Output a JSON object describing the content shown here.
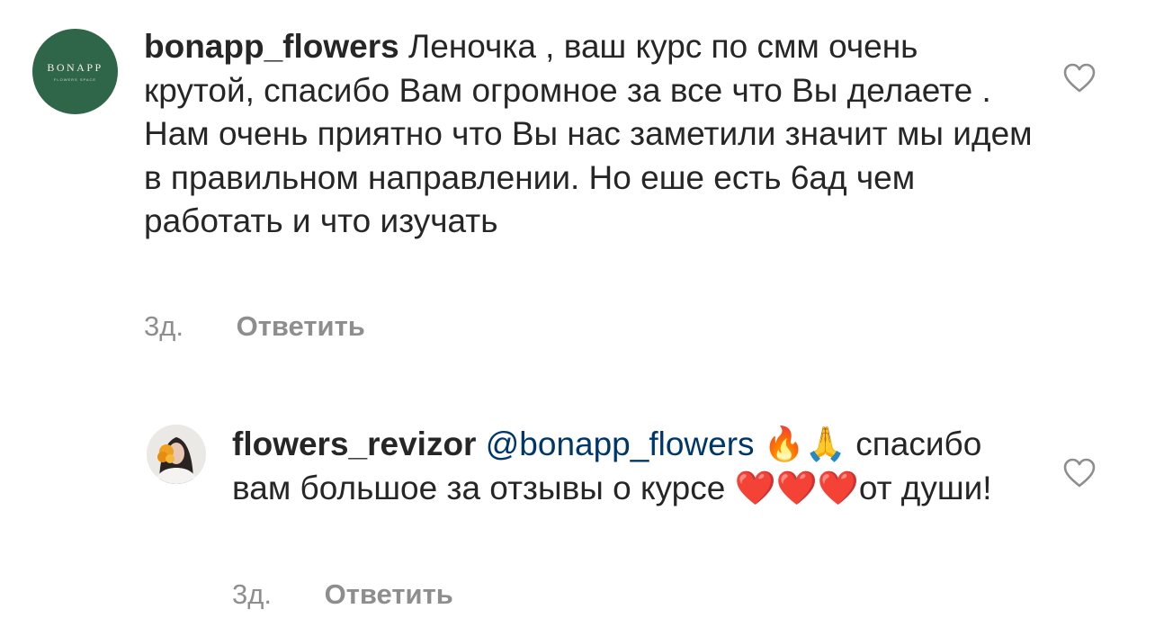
{
  "comments": [
    {
      "username": "bonapp_flowers",
      "avatar_logo_text": "BONAPP",
      "avatar_logo_subtext": "FLOWERS SPACE",
      "avatar_color": "#2f6548",
      "text": "Леночка , ваш курс по смм очень крутой, спасибо  Вам огромное  за все что Вы делаете . Нам очень приятно что Вы нас заметили значит мы идем в правильном направлении.  Но еше есть 6ад чем работать и что изучать",
      "time": "3д.",
      "reply_label": "Ответить",
      "like_icon": "heart-outline-icon"
    },
    {
      "username": "flowers_revizor",
      "mention": "@bonapp_flowers",
      "emojis_after_mention": "🔥🙏",
      "text": "спасибо вам большое за отзывы о курсе",
      "emojis_before_end": "❤️❤️❤️",
      "text_end": "от души!",
      "time": "3д.",
      "reply_label": "Ответить",
      "like_icon": "heart-outline-icon"
    }
  ],
  "colors": {
    "text": "#262626",
    "meta": "#8e8e8e",
    "mention": "#00376b"
  }
}
